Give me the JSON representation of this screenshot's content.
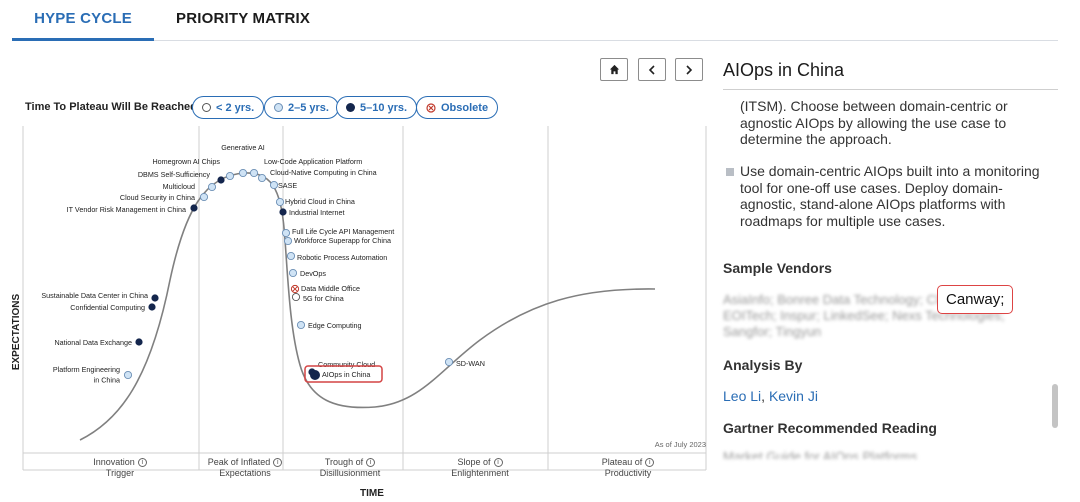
{
  "tabs": [
    {
      "label": "HYPE CYCLE",
      "active": true
    },
    {
      "label": "PRIORITY MATRIX",
      "active": false
    }
  ],
  "nav": {
    "home_icon": "home-icon",
    "prev_icon": "chevron-left-icon",
    "next_icon": "chevron-right-icon"
  },
  "legend": {
    "label": "Time To Plateau Will Be Reached:",
    "items": [
      {
        "label": "< 2 yrs.",
        "icon": "open-circle"
      },
      {
        "label": "2–5 yrs.",
        "icon": "light-blue-circle"
      },
      {
        "label": "5–10 yrs.",
        "icon": "dark-navy-circle"
      },
      {
        "label": "Obsolete",
        "icon": "crossed-circle"
      }
    ]
  },
  "chart": {
    "y_axis_label": "EXPECTATIONS",
    "x_axis_label": "TIME",
    "as_of": "As of July 2023",
    "phases": [
      [
        "Innovation",
        "Trigger"
      ],
      [
        "Peak of Inflated",
        "Expectations"
      ],
      [
        "Trough of",
        "Disillusionment"
      ],
      [
        "Slope of",
        "Enlightenment"
      ],
      [
        "Plateau of",
        "Productivity"
      ]
    ],
    "items": [
      {
        "name": "Platform Engineering in China",
        "label_lines": [
          "Platform Engineering",
          "in China"
        ],
        "plateau": "2-5"
      },
      {
        "name": "National Data Exchange",
        "plateau": "5-10"
      },
      {
        "name": "Confidential Computing",
        "plateau": "5-10"
      },
      {
        "name": "Sustainable Data Center in China",
        "plateau": "5-10"
      },
      {
        "name": "IT Vendor Risk Management in China",
        "plateau": "5-10"
      },
      {
        "name": "Cloud Security in China",
        "plateau": "2-5"
      },
      {
        "name": "Multicloud",
        "plateau": "2-5"
      },
      {
        "name": "DBMS Self-Sufficiency",
        "plateau": "5-10"
      },
      {
        "name": "Homegrown AI Chips",
        "plateau": "2-5"
      },
      {
        "name": "Generative AI",
        "plateau": "2-5"
      },
      {
        "name": "Low-Code Application Platform",
        "plateau": "2-5"
      },
      {
        "name": "Cloud-Native Computing in China",
        "plateau": "2-5"
      },
      {
        "name": "SASE",
        "plateau": "2-5"
      },
      {
        "name": "Hybrid Cloud in China",
        "plateau": "2-5"
      },
      {
        "name": "Industrial Internet",
        "plateau": "5-10"
      },
      {
        "name": "Full Life Cycle API Management",
        "plateau": "2-5"
      },
      {
        "name": "Workforce Superapp for China",
        "plateau": "2-5"
      },
      {
        "name": "Robotic Process Automation",
        "plateau": "2-5"
      },
      {
        "name": "DevOps",
        "plateau": "2-5"
      },
      {
        "name": "Data Middle Office",
        "plateau": "obsolete"
      },
      {
        "name": "5G for China",
        "plateau": "<2"
      },
      {
        "name": "Edge Computing",
        "plateau": "2-5"
      },
      {
        "name": "Community Cloud",
        "plateau": "5-10"
      },
      {
        "name": "AIOps in China",
        "plateau": "5-10",
        "highlighted": true
      },
      {
        "name": "SD-WAN",
        "plateau": "2-5"
      }
    ]
  },
  "panel": {
    "title": "AIOps in China",
    "paragraph_1": "(ITSM). Choose between domain-centric or agnostic AIOps by allowing the use case to determine the approach.",
    "bullet": "Use domain-centric AIOps built into a monitoring tool for one-off use cases. Deploy domain-agnostic, stand-alone AIOps platforms with roadmaps for multiple use cases.",
    "sample_vendors_heading": "Sample Vendors",
    "vendors_blurred": "AsiaInfo; Bonree Data Technology; Cloudwise; EOITech; Inspur; LinkedSee; Nexs Technologies; Sangfor; Tingyun",
    "vendor_highlight": "Canway;",
    "analysis_heading": "Analysis By",
    "analysts": [
      "Leo Li",
      "Kevin Ji"
    ],
    "analyst_sep": ", ",
    "reading_heading": "Gartner Recommended Reading",
    "reading_blurred": "Market Guide for AIOps Platforms"
  },
  "colors": {
    "accent": "#2a6db5",
    "navy": "#14264d",
    "light_blue": "#cfe3f5",
    "highlight_red": "#d44444"
  }
}
